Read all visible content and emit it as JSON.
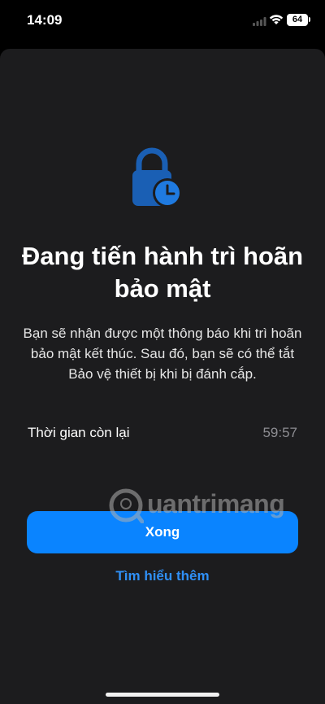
{
  "status_bar": {
    "time": "14:09",
    "battery": "64"
  },
  "sheet": {
    "title": "Đang tiến hành trì hoãn bảo mật",
    "description": "Bạn sẽ nhận được một thông báo khi trì hoãn bảo mật kết thúc. Sau đó, bạn sẽ có thể tắt Bảo vệ thiết bị khi bị đánh cắp.",
    "time_remaining_label": "Thời gian còn lại",
    "time_remaining_value": "59:57",
    "done_button": "Xong",
    "learn_more_link": "Tìm hiểu thêm"
  },
  "watermark": {
    "text": "uantrimang"
  },
  "icons": {
    "lock": "lock-clock-icon",
    "wifi": "wifi-icon",
    "signal": "signal-icon",
    "battery": "battery-icon"
  },
  "colors": {
    "accent": "#0a84ff",
    "sheet_bg": "#1c1c1e",
    "lock_blue": "#1a73e8"
  }
}
